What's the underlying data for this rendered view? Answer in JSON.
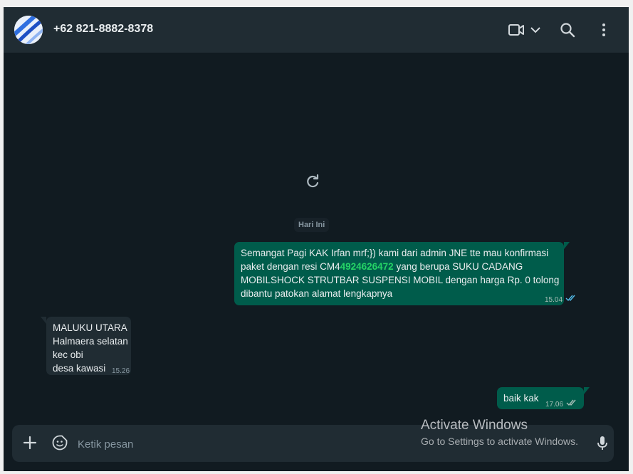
{
  "header": {
    "contact_name": "+62 821-8882-8378",
    "icons": [
      "video-call-icon",
      "chevron-down-icon",
      "search-icon",
      "menu-icon"
    ]
  },
  "chat": {
    "date_label": "Hari Ini",
    "messages": [
      {
        "direction": "outgoing",
        "text_before": "Semangat Pagi KAK Irfan mrf;}) kami dari admin JNE tte mau konfirmasi paket dengan resi CM4",
        "highlight": "4924626472",
        "text_after": " yang berupa SUKU CADANG MOBILSHOCK STRUTBAR SUSPENSI MOBIL dengan harga Rp. 0 tolong dibantu patokan alamat lengkapnya",
        "time": "15.04",
        "status": "read"
      },
      {
        "direction": "incoming",
        "text": "MALUKU UTARA\nHalmaera selatan\nkec obi\ndesa kawasi",
        "time": "15.26"
      },
      {
        "direction": "outgoing",
        "text": "baik kak",
        "time": "17.06",
        "status": "delivered"
      }
    ]
  },
  "composer": {
    "placeholder": "Ketik pesan",
    "value": ""
  },
  "watermark": {
    "title": "Activate Windows",
    "subtitle": "Go to Settings to activate Windows."
  },
  "colors": {
    "header_bg": "#202c33",
    "chat_bg": "#111b21",
    "outgoing_bubble": "#005c4b",
    "incoming_bubble": "#202c33",
    "highlight_text": "#25d366",
    "read_tick": "#53bdeb"
  }
}
